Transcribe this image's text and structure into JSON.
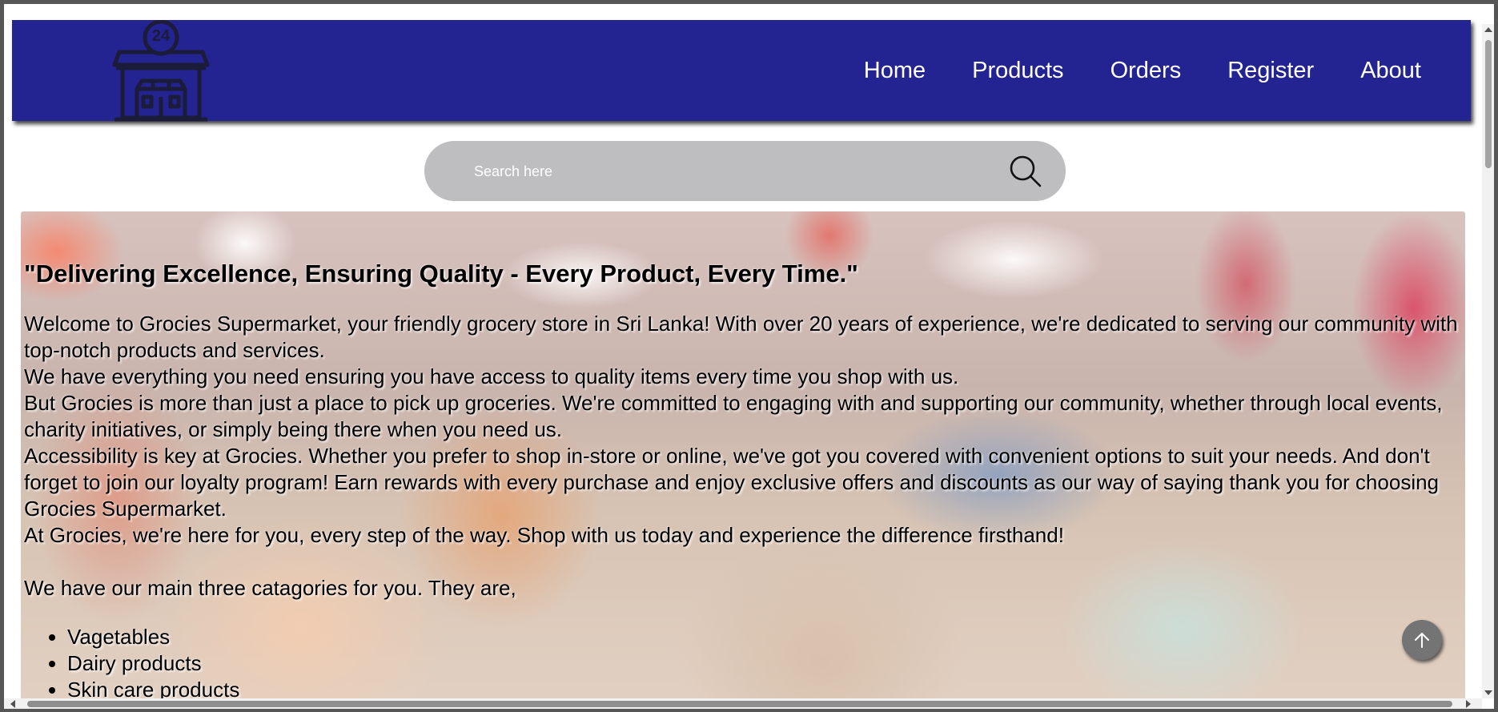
{
  "navbar": {
    "logo_text": "24",
    "links": [
      {
        "label": "Home"
      },
      {
        "label": "Products"
      },
      {
        "label": "Orders"
      },
      {
        "label": "Register"
      },
      {
        "label": "About"
      }
    ]
  },
  "search": {
    "placeholder": "Search here",
    "icon": "search-icon"
  },
  "hero": {
    "heading": "\"Delivering Excellence, Ensuring Quality - Every Product, Every Time.\"",
    "paragraphs": [
      "Welcome to Grocies Supermarket, your friendly grocery store in Sri Lanka! With over 20 years of experience, we're dedicated to serving our community with top-notch products and services.",
      "We have everything you need ensuring you have access to quality items every time you shop with us.",
      "But Grocies is more than just a place to pick up groceries. We're committed to engaging with and supporting our community, whether through local events, charity initiatives, or simply being there when you need us.",
      "Accessibility is key at Grocies. Whether you prefer to shop in-store or online, we've got you covered with convenient options to suit your needs. And don't forget to join our loyalty program! Earn rewards with every purchase and enjoy exclusive offers and discounts as our way of saying thank you for choosing Grocies Supermarket.",
      "At Grocies, we're here for you, every step of the way. Shop with us today and experience the difference firsthand!"
    ],
    "intro": "We have our main three catagories for you. They are,",
    "categories": [
      "Vagetables",
      "Dairy products",
      "Skin care products"
    ]
  },
  "colors": {
    "navbar_bg": "#232392",
    "search_bg": "#bebdbf",
    "scroll_top_bg": "#747474"
  },
  "icons": {
    "logo": "store-24-icon",
    "scroll_top": "arrow-up-icon"
  }
}
